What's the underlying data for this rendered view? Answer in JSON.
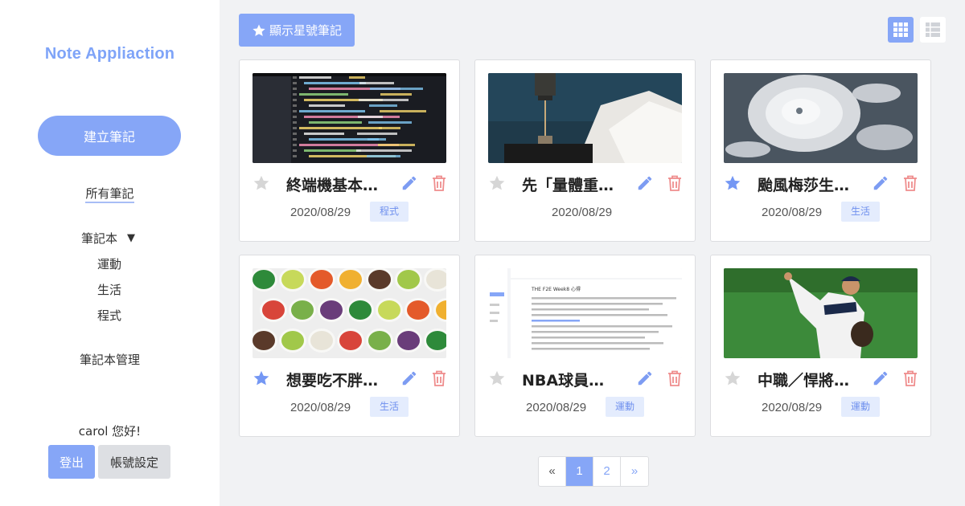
{
  "app": {
    "title": "Note Appliaction"
  },
  "sidebar": {
    "create_label": "建立筆記",
    "all_notes_label": "所有筆記",
    "notebook_label": "筆記本",
    "notebook_arrow": "▼",
    "notebooks": [
      "運動",
      "生活",
      "程式"
    ],
    "manage_label": "筆記本管理",
    "greeting": "carol 您好!",
    "logout_label": "登出",
    "settings_label": "帳號設定"
  },
  "toolbar": {
    "starred_label": "顯示星號筆記",
    "view_grid_icon": "grid-view-icon",
    "view_list_icon": "list-view-icon"
  },
  "colors": {
    "accent": "#86a6f7",
    "star_active": "#7497f4",
    "star_inactive": "#d6d6d6",
    "edit": "#7d9cf2",
    "delete": "#ef8d8d",
    "tag_bg": "#e4ecfd"
  },
  "notes": [
    {
      "title": "終端機基本…",
      "date": "2020/08/29",
      "tag": "程式",
      "starred": false,
      "image": "code-screen"
    },
    {
      "title": "先「量體重…",
      "date": "2020/08/29",
      "tag": "",
      "starred": false,
      "image": "bed-pillows"
    },
    {
      "title": "颱風梅莎生…",
      "date": "2020/08/29",
      "tag": "生活",
      "starred": true,
      "image": "typhoon-satellite"
    },
    {
      "title": "想要吃不胖…",
      "date": "2020/08/29",
      "tag": "生活",
      "starred": true,
      "image": "food-bowls"
    },
    {
      "title": "NBA球員…",
      "date": "2020/08/29",
      "tag": "運動",
      "starred": false,
      "image": "article-screenshot"
    },
    {
      "title": "中職／悍將…",
      "date": "2020/08/29",
      "tag": "運動",
      "starred": false,
      "image": "baseball-pitcher"
    }
  ],
  "image_texts": {
    "article_heading": "THE F2E Week8 心得"
  },
  "pagination": {
    "prev": "«",
    "pages": [
      "1",
      "2"
    ],
    "current": "1",
    "next": "»"
  }
}
